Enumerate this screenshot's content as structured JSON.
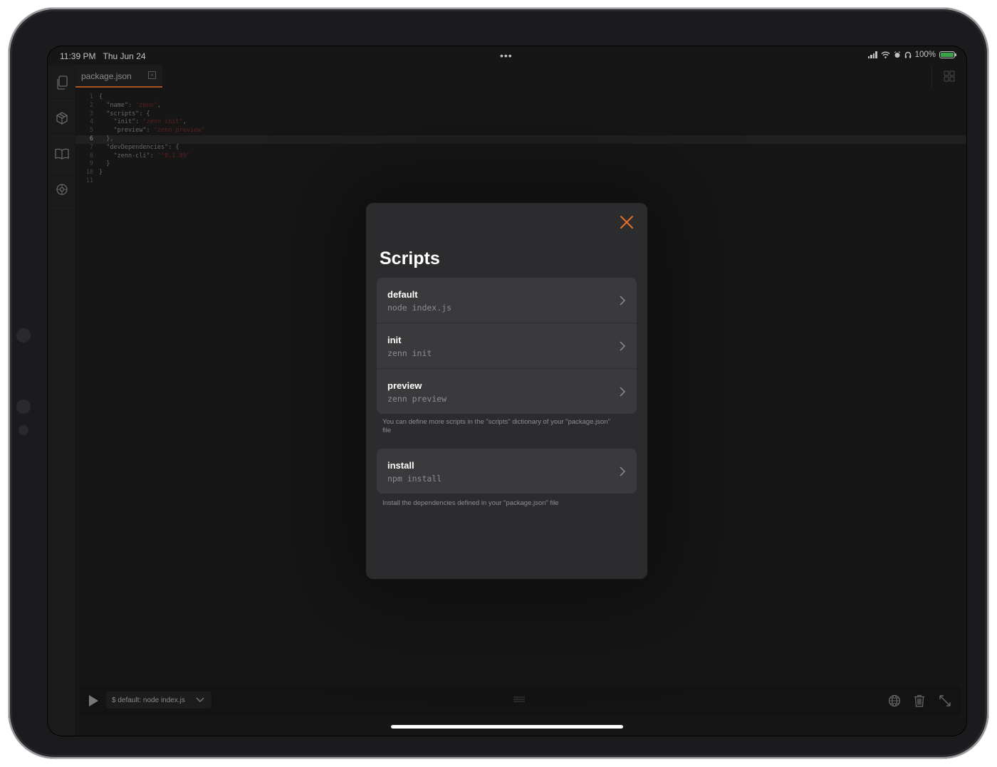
{
  "status": {
    "time": "11:39 PM",
    "date": "Thu Jun 24",
    "battery": "100%"
  },
  "sidebar": {
    "items": [
      {
        "icon": "files-icon"
      },
      {
        "icon": "package-icon"
      },
      {
        "icon": "book-icon"
      },
      {
        "icon": "settings-icon"
      }
    ]
  },
  "tabs": [
    {
      "label": "package.json",
      "active": true
    }
  ],
  "editor": {
    "active_line": 6,
    "lines": [
      {
        "n": "1",
        "text": "{"
      },
      {
        "n": "2",
        "key": "  \"name\": ",
        "str": "\"zenn\"",
        "end": ","
      },
      {
        "n": "3",
        "text": "  \"scripts\": {"
      },
      {
        "n": "4",
        "key": "    \"init\": ",
        "str": "\"zenn init\"",
        "end": ","
      },
      {
        "n": "5",
        "key": "    \"preview\": ",
        "str": "\"zenn preview\"",
        "end": ""
      },
      {
        "n": "6",
        "text": "  },"
      },
      {
        "n": "7",
        "text": "  \"devDependencies\": {"
      },
      {
        "n": "8",
        "key": "    \"zenn-cli\": ",
        "str": "\"^0.1.89\"",
        "end": ""
      },
      {
        "n": "9",
        "text": "  }"
      },
      {
        "n": "10",
        "text": "}"
      },
      {
        "n": "11",
        "text": ""
      }
    ]
  },
  "modal": {
    "title": "Scripts",
    "scripts": [
      {
        "name": "default",
        "command": "node index.js"
      },
      {
        "name": "init",
        "command": "zenn init"
      },
      {
        "name": "preview",
        "command": "zenn preview"
      }
    ],
    "scripts_footnote": "You can define more scripts in the \"scripts\" dictionary of your \"package.json\" file",
    "install": {
      "name": "install",
      "command": "npm install"
    },
    "install_footnote": "Install the dependencies defined in your \"package.json\" file"
  },
  "bottombar": {
    "selected_script": "$ default: node index.js"
  },
  "colors": {
    "accent": "#e07028",
    "background": "#1e1e1e",
    "modal": "#2c2c2e",
    "row": "#3a3a3c",
    "string": "#7a2a2a"
  }
}
